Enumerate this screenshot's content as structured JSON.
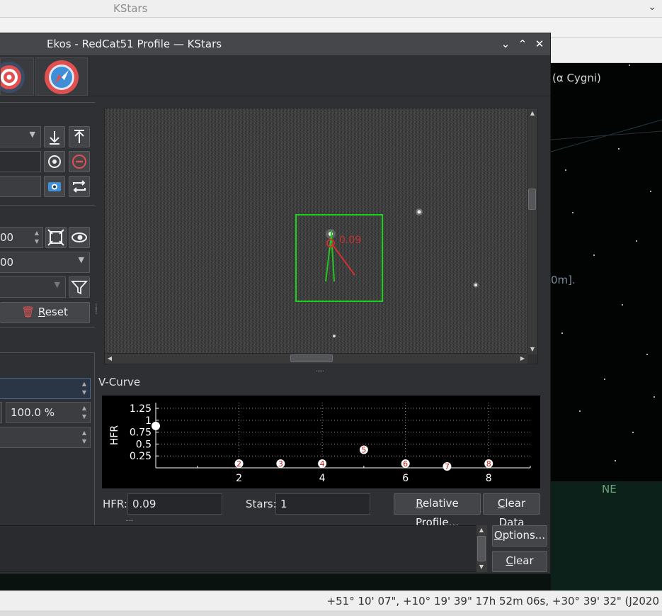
{
  "kstars": {
    "window_title": "KStars",
    "sky_labels": {
      "cygni": "(α Cygni)",
      "partial_label": "0m].",
      "direction": "NE"
    },
    "status_text": "+51° 10' 07\", +10° 19' 39\"  17h 52m 06s, +30° 39' 32\" (J2020"
  },
  "ekos": {
    "window_title": "Ekos - RedCat51 Profile — KStars",
    "window_buttons": [
      "⌄",
      "⌃",
      "✕"
    ],
    "module_tabs": [
      {
        "name": "focus-module-tab",
        "icon": "target-icon"
      },
      {
        "name": "guide-module-tab",
        "icon": "compass-icon"
      }
    ],
    "left_panel": {
      "exposure_value": "00",
      "gain_value": "00",
      "reset_label_prefix": "",
      "reset_label_mnemonic": "R",
      "reset_label_rest": "eset",
      "percent_value": "100.0 %"
    },
    "vcurve": {
      "title": "V-Curve",
      "hfr_label": "HFR:",
      "hfr_value": "0.09",
      "stars_label": "Stars:",
      "stars_value": "1",
      "relative_profile_mnemonic": "R",
      "relative_profile_rest": "elative Profile...",
      "clear_data_mnemonic": "C",
      "clear_data_rest": "lear Data"
    },
    "star_annotation": "0.09",
    "log": {
      "options_mnemonic": "O",
      "options_rest": "ptions...",
      "clear_mnemonic": "C",
      "clear_rest": "lear"
    }
  },
  "chart_data": {
    "type": "scatter",
    "title": "V-Curve",
    "xlabel": "",
    "ylabel": "HFR",
    "xlim": [
      0,
      9
    ],
    "ylim": [
      0,
      1.37
    ],
    "x_ticks": [
      "2",
      "4",
      "6",
      "8"
    ],
    "y_ticks": [
      "1.25",
      "1",
      "0.75",
      "0.5",
      "0.25"
    ],
    "grid": true,
    "series": [
      {
        "points": [
          {
            "x": 0,
            "y": 0.88,
            "label": ""
          },
          {
            "x": 2,
            "y": 0.09,
            "label": "2"
          },
          {
            "x": 3,
            "y": 0.09,
            "label": "3"
          },
          {
            "x": 4,
            "y": 0.09,
            "label": "4"
          },
          {
            "x": 5,
            "y": 0.38,
            "label": "5"
          },
          {
            "x": 6,
            "y": 0.09,
            "label": "6"
          },
          {
            "x": 7,
            "y": 0.03,
            "label": "7"
          },
          {
            "x": 8,
            "y": 0.09,
            "label": "8"
          }
        ]
      }
    ]
  }
}
